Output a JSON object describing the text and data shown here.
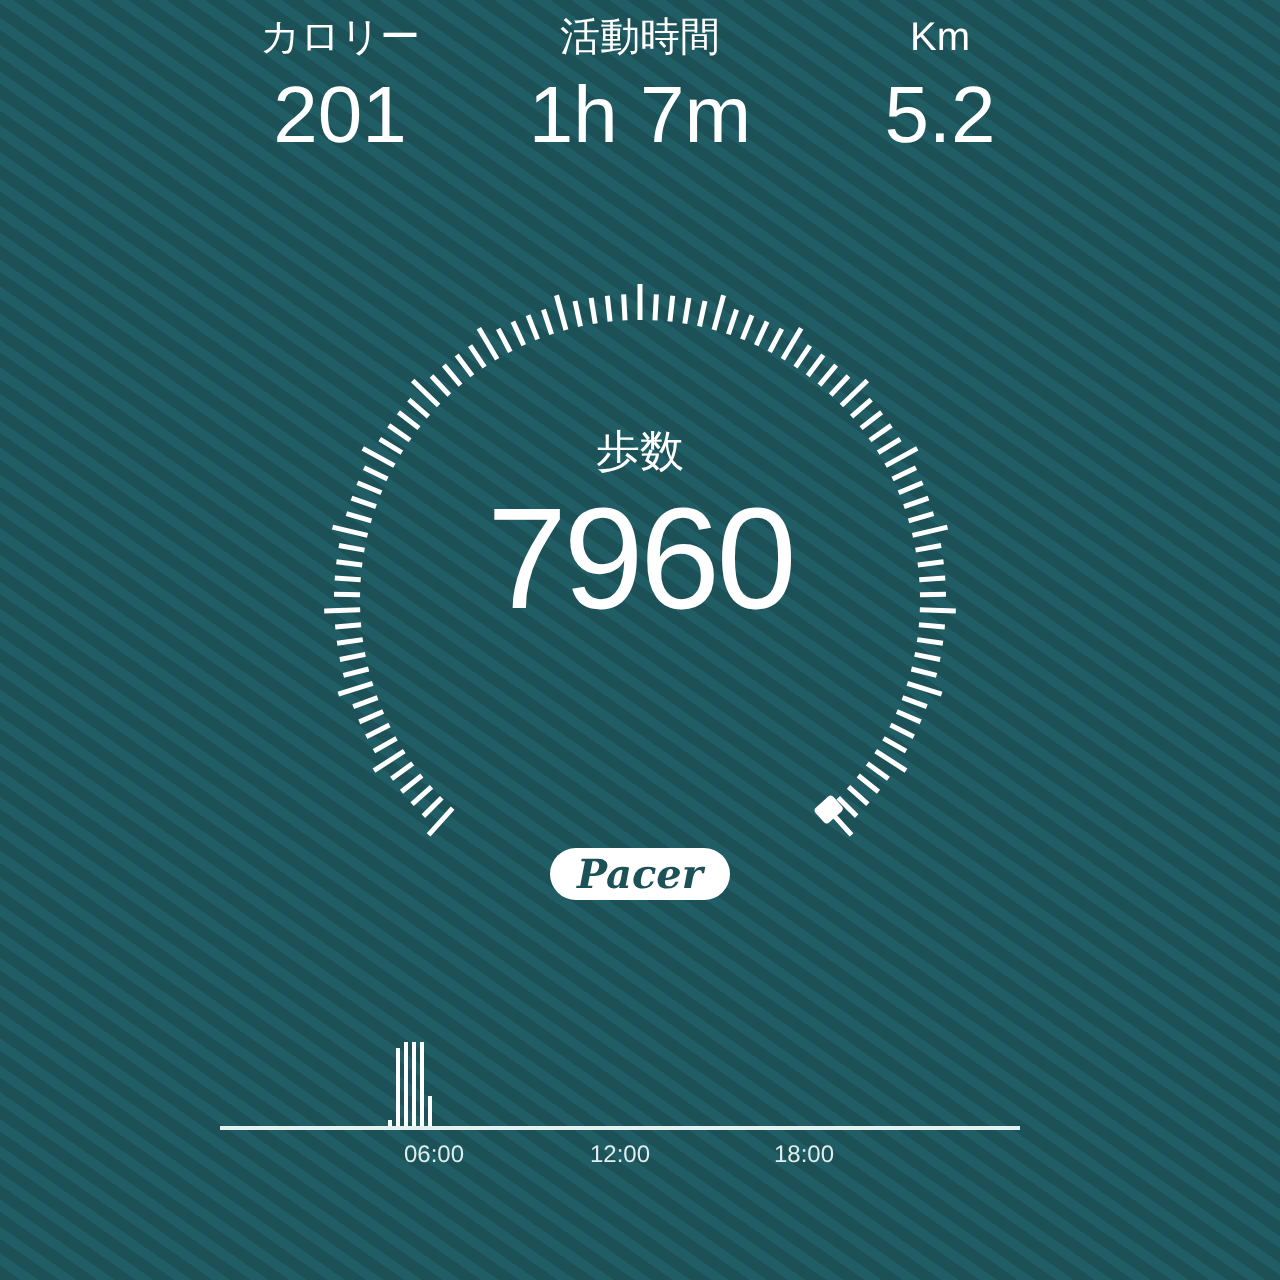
{
  "stats": [
    {
      "label": "カロリー",
      "value": "201"
    },
    {
      "label": "活動時間",
      "value": "1h 7m"
    },
    {
      "label": "Km",
      "value": "5.2"
    }
  ],
  "gauge": {
    "label": "歩数",
    "value": "7960"
  },
  "logo": {
    "text": "Pacer"
  },
  "timeline": {
    "ticks": [
      "06:00",
      "12:00",
      "18:00"
    ]
  }
}
